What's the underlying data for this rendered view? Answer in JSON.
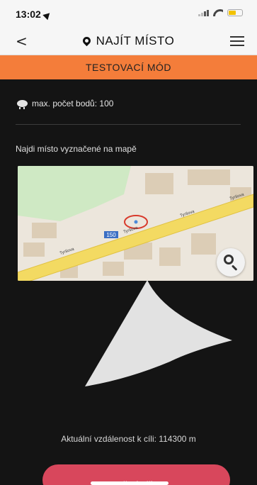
{
  "status_bar": {
    "time": "13:02"
  },
  "nav": {
    "title": "NAJÍT MÍSTO",
    "back_glyph": "<",
    "icons": [
      "location-arrow-icon",
      "map-pin-icon",
      "hamburger-menu-icon",
      "back-chevron-icon",
      "signal-icon",
      "wifi-icon",
      "battery-icon"
    ]
  },
  "mode_banner": {
    "label": "TESTOVACÍ MÓD",
    "color": "#f47d3a"
  },
  "points": {
    "label": "max. počet bodů: 100",
    "icon": "piggy-bank-icon"
  },
  "instruction": {
    "text": "Najdi místo vyznačené na mapě"
  },
  "map": {
    "road_number": "150",
    "street_labels": [
      "Tyršova",
      "Tyršova",
      "Tyršova",
      "Tyršova"
    ],
    "zoom_icon": "magnifier-icon"
  },
  "distance": {
    "text": "Aktuální vzdálenost k cíli: 114300 m"
  },
  "skip_button": {
    "label": "Přeskočit",
    "color": "#d8475c"
  },
  "colors": {
    "background": "#141414",
    "bars": "#f6f6f6"
  }
}
